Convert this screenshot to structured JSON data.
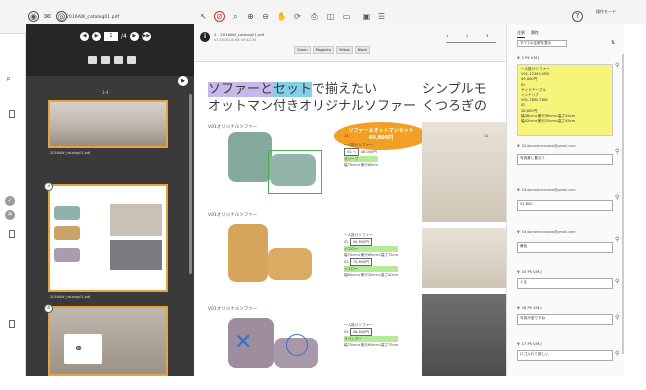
{
  "app": {
    "title": "2016AW_catalog01.pdf",
    "mode_label": "操作モード"
  },
  "colors": {
    "accent": "#e8a33c",
    "highlight_yellow": "#f7f47a",
    "oval": "#f2a025"
  },
  "toolbar": {
    "icons": [
      "logo-icon",
      "email-icon",
      "at-icon",
      "pointer-icon",
      "no-entry-icon",
      "search-icon",
      "zoom-icon",
      "zoom-out-icon",
      "hand-icon",
      "refresh-icon",
      "print-icon",
      "camera-icon",
      "text-icon",
      "share-icon",
      "list-icon"
    ],
    "help": "?"
  },
  "left_panel": {
    "page_input": "1",
    "page_total": "/4",
    "page_label": "1-4",
    "thumbs": [
      {
        "num": "",
        "label": "2016AW_catalog01.pdf"
      },
      {
        "num": "3",
        "label": "2016AW_catalog01.pdf"
      },
      {
        "num": "4",
        "label": ""
      }
    ]
  },
  "document": {
    "name": "2 - 2016AW_catalog01.pdf",
    "date": "v3 2016.05.08 09:42:35",
    "color_buttons": [
      "Green",
      "Magenta",
      "Yellow",
      "Black"
    ],
    "zoom_labels": [
      "1",
      "2",
      "3"
    ],
    "title_line1_hl1": "ソファーと",
    "title_line1_hl2": "セット",
    "title_line1_rest": "で揃えたい",
    "title_line2": "オットマン付きオリジナルソファー",
    "title_right1": "シンプルモ",
    "title_right2": "くつろぎの",
    "oval_line1": "ソファー＆オットマンセット",
    "oval_line2": "60,800円",
    "sections": [
      "V01オリジナルソファー",
      "V01オリジナルソファー",
      "V01オリジナルソファー"
    ],
    "specs1": [
      "一人掛けソファー",
      "V1 ～",
      "48,000円",
      "オリーブ",
      "幅75cm×奥行65cm"
    ],
    "specs2": [
      "一人掛けソファー",
      "S2",
      "40,800円",
      "イエロー",
      "幅75cm×奥行65cm×高さ75cm",
      "S3",
      "70,800円",
      "イエロー",
      "幅60cm×奥行30cm×高さ40cm"
    ],
    "specs3": [
      "一人掛けソファー",
      "S3",
      "48,800円",
      "ラベンダー",
      "幅75cm×奥行65cm×高さ75cm"
    ],
    "note_markers": [
      "1A",
      "11"
    ]
  },
  "comments_panel": {
    "tabs": [
      "注釈",
      "属性"
    ],
    "filter": "すべての注釈を表示",
    "sort_icon": "⇅",
    "items": [
      {
        "id": "1",
        "header": "P4 V.M.J",
        "lines": [
          "一人掛けソファー",
          "V01-12345-VBS",
          "49,000円",
          "ID",
          "サイドテーブル",
          "インテリア",
          "V01-7890-TWR",
          "ID",
          "28,600円",
          "幅46cm×奥行36cm×高さ52cm",
          "幅42cm×奥行25cm×高さ45cm"
        ]
      },
      {
        "id": "12",
        "meta": "domomorizawa@gmail.com",
        "text": "写真差し替えて"
      },
      {
        "id": "13",
        "meta": "domomorizawa@gmail.com",
        "text": "52,800"
      },
      {
        "id": "14",
        "meta": "domomorizawa@gmail.com",
        "text": "黄色"
      },
      {
        "id": "15",
        "header": "P5 V.M.J",
        "text": "ぐる"
      },
      {
        "id": "16",
        "header": "P5 V.M.J",
        "text": "写真が逆ですね"
      },
      {
        "id": "17",
        "header": "P5 V.M.J",
        "text": "ロゴ入れて欲しい"
      }
    ]
  }
}
